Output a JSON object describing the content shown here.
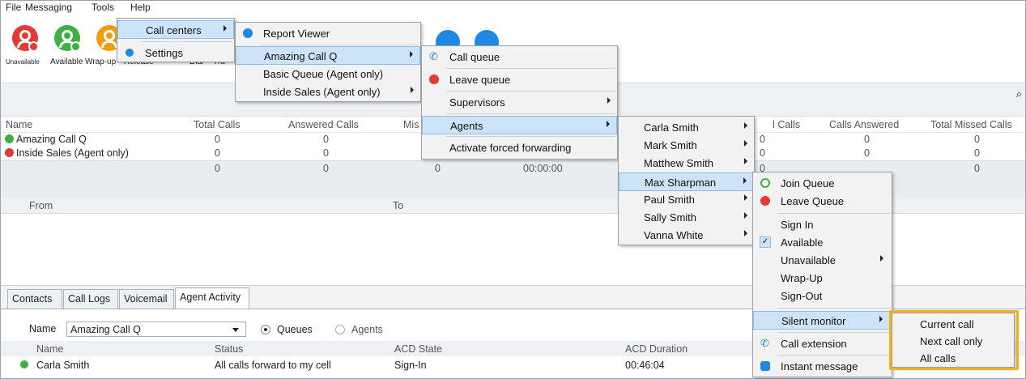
{
  "menubar": {
    "file": "File",
    "messaging": "Messaging",
    "tools": "Tools",
    "help": "Help"
  },
  "toolbar": {
    "unavailable": "Unavailable",
    "available": "Available",
    "wrapup": "Wrap-up",
    "release": "Release",
    "dial": "Dial",
    "transfer": "Tra"
  },
  "queues_table": {
    "headers": {
      "name": "Name",
      "total_calls": "Total Calls",
      "answered_calls": "Answered Calls",
      "missed": "Mis",
      "calls_partial": "l Calls",
      "calls_answered": "Calls Answered",
      "total_missed": "Total Missed Calls"
    },
    "rows": [
      {
        "name": "Amazing Call Q",
        "total": "0",
        "answered": "0",
        "calls2": "0",
        "calls_answered": "0",
        "total_missed": "0",
        "status_color": "#3cb043"
      },
      {
        "name": "Inside Sales (Agent only)",
        "total": "0",
        "answered": "0",
        "calls2": "0",
        "calls_answered": "0",
        "total_missed": "0",
        "status_color": "#e53935"
      }
    ],
    "totals": {
      "total": "0",
      "answered": "0",
      "missed": "0",
      "time": "00:00:00",
      "calls2": "0",
      "total_missed": "0"
    }
  },
  "calls_table": {
    "headers": {
      "from": "From",
      "to": "To"
    }
  },
  "tabs": [
    "Contacts",
    "Call Logs",
    "Voicemail",
    "Agent Activity"
  ],
  "agent_activity": {
    "name_label": "Name",
    "queue_select": "Amazing Call Q",
    "radio_queues": "Queues",
    "radio_agents": "Agents",
    "headers": {
      "name": "Name",
      "status": "Status",
      "acd_state": "ACD State",
      "acd_duration": "ACD Duration"
    },
    "rows": [
      {
        "name": "Carla Smith",
        "status": "All calls forward to my cell",
        "acd_state": "Sign-In",
        "duration": "00:46:04"
      }
    ]
  },
  "menus": {
    "tools": {
      "call_centers": "Call centers",
      "settings": "Settings"
    },
    "call_centers": {
      "report_viewer": "Report Viewer",
      "amazing_call_q": "Amazing Call Q",
      "basic_queue": "Basic Queue (Agent only)",
      "inside_sales": "Inside Sales (Agent only)"
    },
    "queue": {
      "call_queue": "Call queue",
      "leave_queue": "Leave queue",
      "supervisors": "Supervisors",
      "agents": "Agents",
      "activate_forwarding": "Activate forced forwarding",
      "time_peek": "00:00:00"
    },
    "agents": [
      "Carla Smith",
      "Mark Smith",
      "Matthew Smith",
      "Max Sharpman",
      "Paul Smith",
      "Sally Smith",
      "Vanna White"
    ],
    "agent_actions": {
      "join_queue": "Join Queue",
      "leave_queue": "Leave Queue",
      "sign_in": "Sign In",
      "available": "Available",
      "unavailable": "Unavailable",
      "wrap_up": "Wrap-Up",
      "sign_out": "Sign-Out",
      "silent_monitor": "Silent monitor",
      "call_extension": "Call extension",
      "instant_message": "Instant message"
    },
    "silent_monitor": {
      "current_call": "Current call",
      "next_call_only": "Next call only",
      "all_calls": "All calls"
    }
  },
  "colors": {
    "accent": "#1e88e5",
    "highlight": "#f2b01e",
    "green": "#3cb043",
    "red": "#e53935",
    "orange": "#f39c12"
  }
}
